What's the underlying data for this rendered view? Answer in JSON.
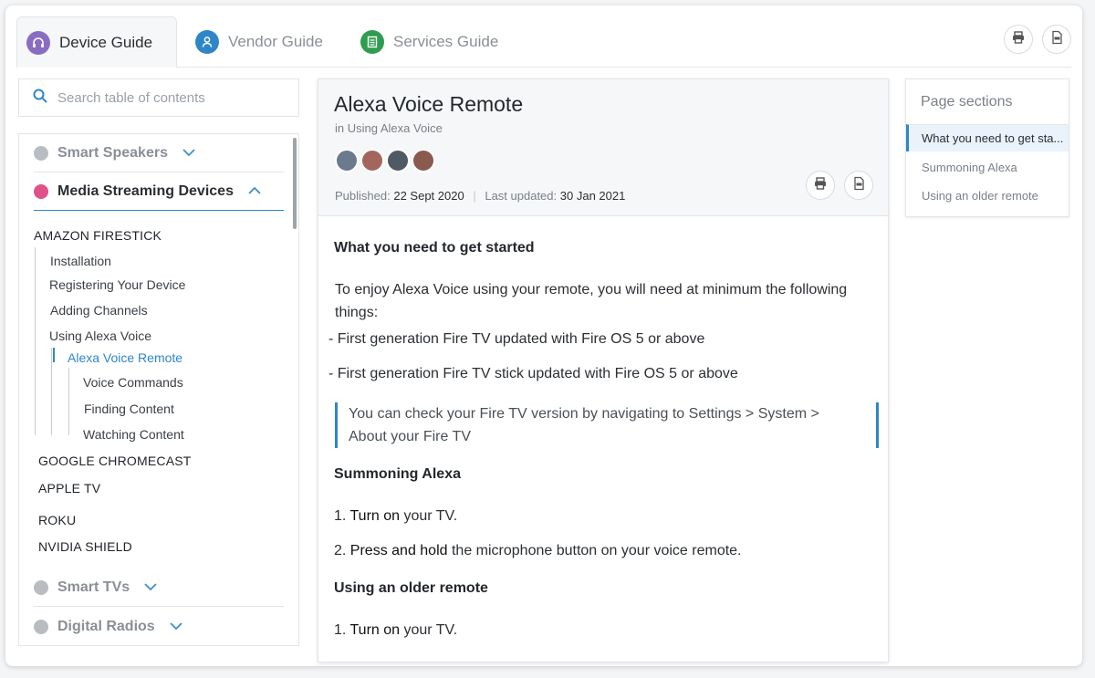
{
  "tabs": [
    {
      "label": "Device Guide",
      "icon": "headset-icon",
      "color": "#8a6dc3"
    },
    {
      "label": "Vendor Guide",
      "icon": "person-icon",
      "color": "#2e86c9"
    },
    {
      "label": "Services Guide",
      "icon": "document-icon",
      "color": "#2f9d4f"
    }
  ],
  "top_actions": [
    "print-icon",
    "pdf-icon"
  ],
  "search": {
    "placeholder": "Search table of contents"
  },
  "toc": {
    "categories": [
      {
        "label": "Smart Speakers",
        "state": "collapsed"
      },
      {
        "label": "Media Streaming Devices",
        "state": "expanded"
      },
      {
        "label": "Smart TVs",
        "state": "collapsed"
      },
      {
        "label": "Digital Radios",
        "state": "collapsed"
      }
    ],
    "group": "AMAZON FIRESTICK",
    "items": [
      "Installation",
      "Registering Your Device",
      "Adding Channels",
      "Using Alexa Voice"
    ],
    "active_item": "Alexa Voice Remote",
    "subitems": [
      "Voice Commands",
      "Finding Content",
      "Watching Content"
    ],
    "devices": [
      "GOOGLE CHROMECAST",
      "APPLE TV",
      "ROKU",
      "NVIDIA SHIELD"
    ]
  },
  "article": {
    "title": "Alexa Voice Remote",
    "subtitle": "in Using Alexa Voice",
    "published_label": "Published:",
    "published": "22 Sept 2020",
    "updated_label": "Last updated:",
    "updated": "30 Jan 2021",
    "avatar_colors": [
      "#6b7a8c",
      "#a2665c",
      "#4f5a64",
      "#8a5a4e"
    ],
    "h_started": "What you need to get started",
    "intro_1": "To enjoy Alexa Voice using your remote, you will need at minimum the following",
    "intro_2": "things:",
    "req_1": "- First generation Fire TV updated with Fire OS 5 or above",
    "req_2": "- First generation Fire TV stick updated with Fire OS 5 or above",
    "callout_1": "You can check your Fire TV version by navigating to Settings > System >",
    "callout_2": "About your Fire TV",
    "h_summon": "Summoning Alexa",
    "step1_num": "1.",
    "step1_bold": "Turn on",
    "step1_rest": "your TV.",
    "step2_num": "2.",
    "step2_bold": "Press and hold",
    "step2_rest": "the microphone button on your voice remote.",
    "h_older": "Using an older remote",
    "older1_num": "1.",
    "older1_bold": "Turn on",
    "older1_rest": "your TV."
  },
  "sections": {
    "title": "Page sections",
    "items": [
      "What you need to get sta...",
      "Summoning Alexa",
      "Using an older remote"
    ]
  }
}
